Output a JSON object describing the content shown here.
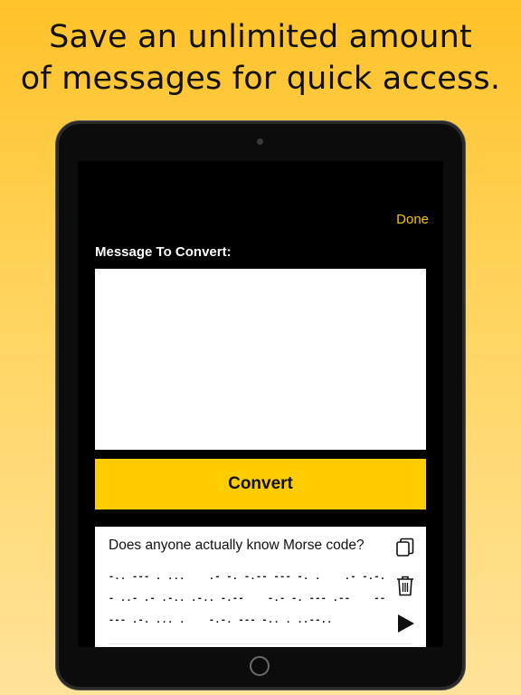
{
  "promo": {
    "line1": "Save an unlimited amount",
    "line2": "of messages for quick access."
  },
  "app": {
    "done_label": "Done",
    "message_label": "Message To Convert:",
    "message_value": "",
    "convert_label": "Convert",
    "accent_color": "#ffcc00"
  },
  "saved_messages": [
    {
      "text": "Does anyone actually know Morse code?",
      "morse_lines": [
        "-.. --- . ...    .- -. -.-- --- -. .    .- -.-.",
        "- ..- .- .-.. .-.. -.--    -.- -. --- .--    --",
        "--- .-. ... .    -.-. --- -.. . ..--.."
      ],
      "icons": [
        "copy-icon",
        "trash-icon",
        "play-icon"
      ]
    }
  ]
}
